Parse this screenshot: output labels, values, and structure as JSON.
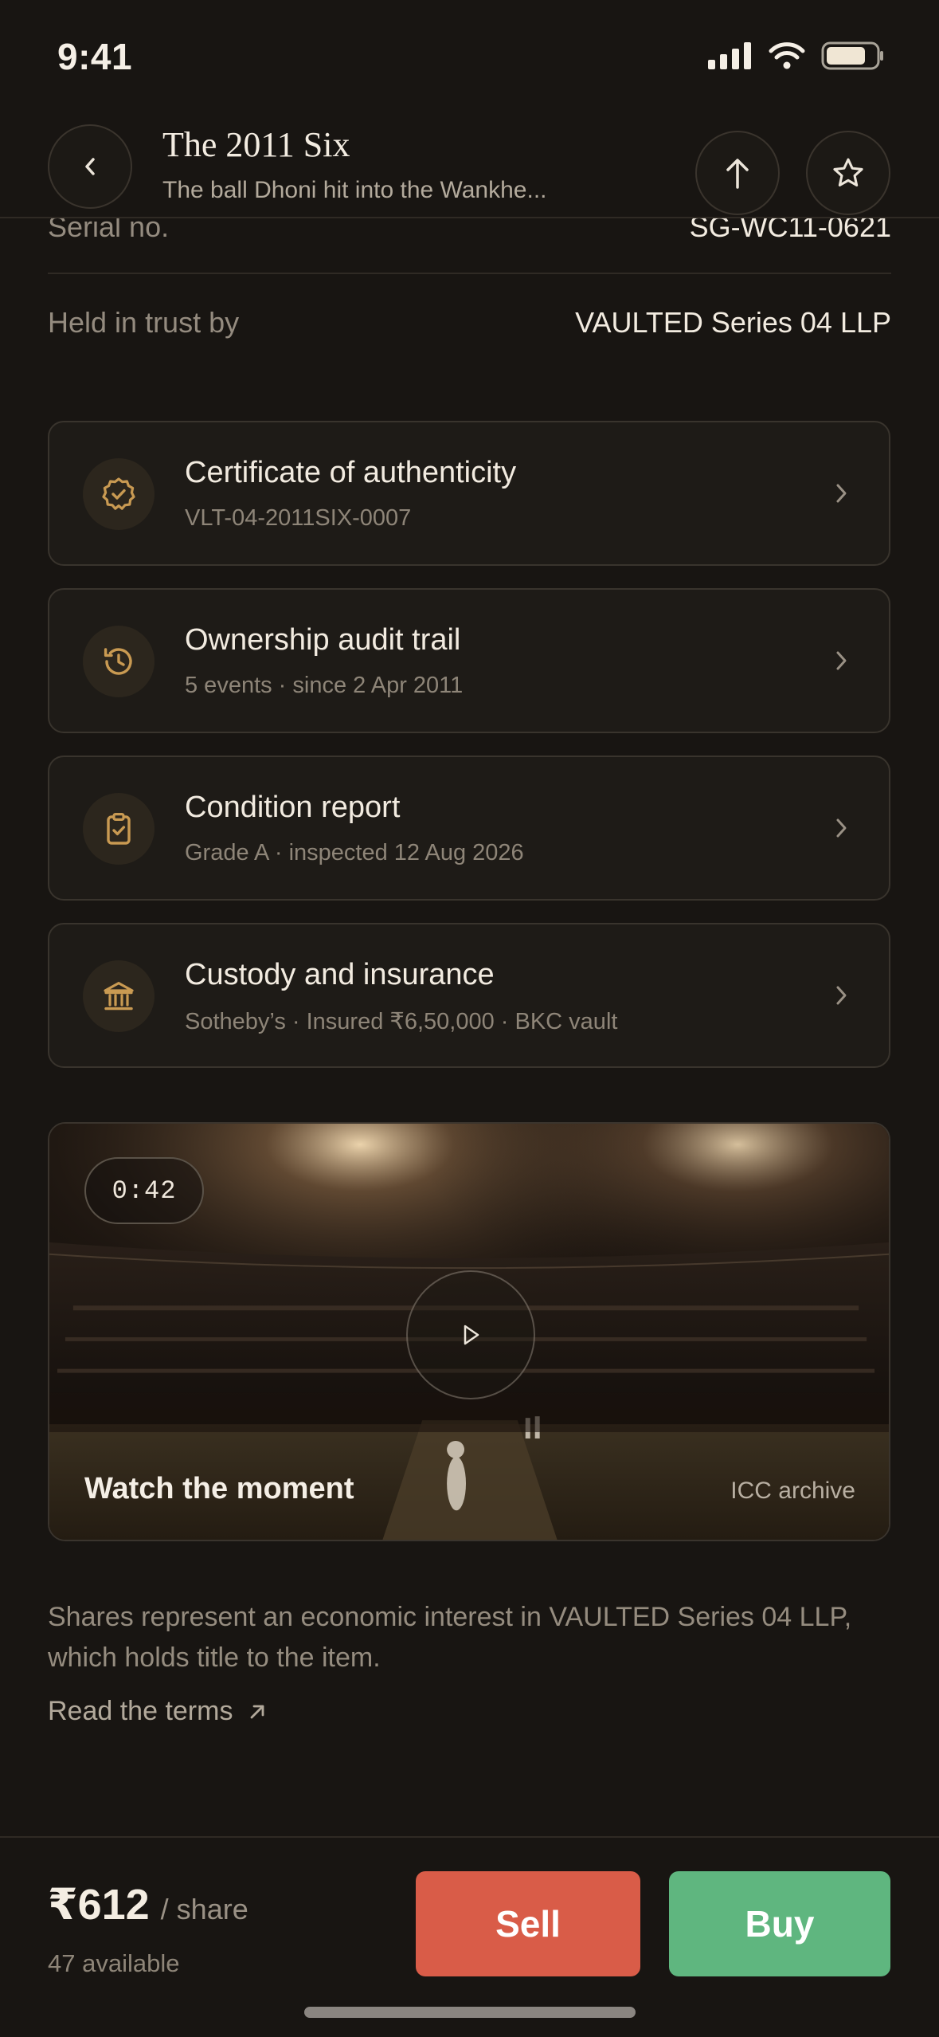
{
  "status_bar": {
    "time": "9:41",
    "battery_level": 0.8
  },
  "header": {
    "title": "The 2011 Six",
    "subtitle": "The ball Dhoni hit into the Wankhe..."
  },
  "details": [
    {
      "label": "Serial no.",
      "value": "SG-WC11-0621"
    },
    {
      "label": "Held in trust by",
      "value": "VAULTED Series 04 LLP"
    }
  ],
  "cards": [
    {
      "icon": "badge-check-icon",
      "title": "Certificate of authenticity",
      "subtitle": "VLT-04-2011SIX-0007"
    },
    {
      "icon": "history-icon",
      "title": "Ownership audit trail",
      "subtitle": "5 events · since 2 Apr 2011"
    },
    {
      "icon": "clipboard-check-icon",
      "title": "Condition report",
      "subtitle": "Grade A · inspected 12 Aug 2026"
    },
    {
      "icon": "bank-icon",
      "title": "Custody and insurance",
      "subtitle": "Sotheby’s · Insured ₹6,50,000 · BKC vault"
    }
  ],
  "video": {
    "duration": "0:42",
    "caption": "Watch the moment",
    "credit": "ICC archive"
  },
  "disclaimer": "Shares represent an economic interest in VAULTED Series 04 LLP, which holds title to the item.",
  "terms_link": "Read the terms",
  "footer": {
    "price": "₹612",
    "unit": "/ share",
    "available": "47 available",
    "sell_label": "Sell",
    "buy_label": "Buy"
  },
  "colors": {
    "background": "#181512",
    "accent_gold": "#c99a52",
    "sell": "#d95c48",
    "buy": "#5fb67f"
  }
}
